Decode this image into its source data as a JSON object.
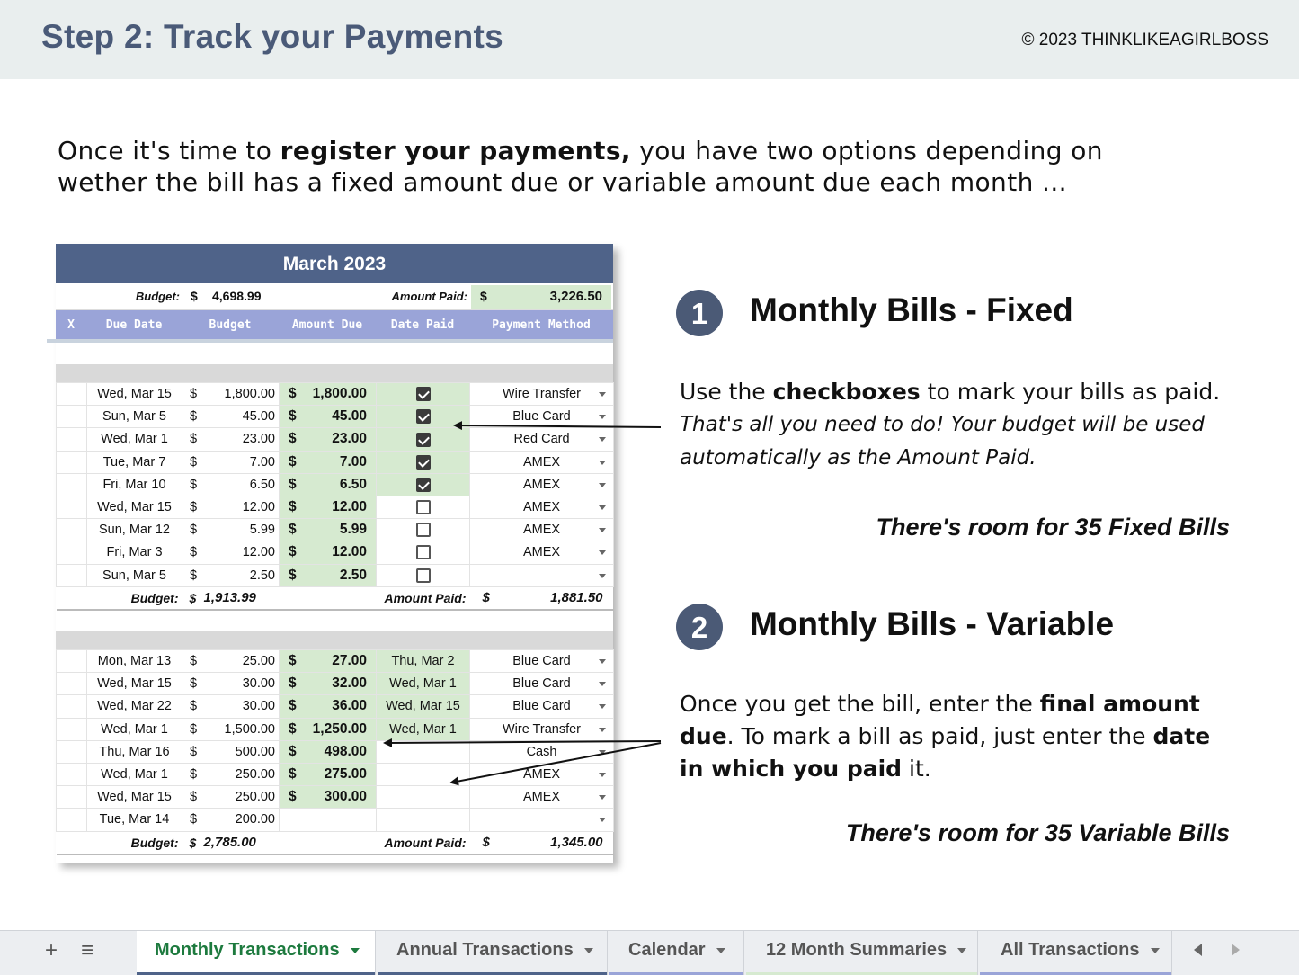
{
  "header": {
    "title": "Step 2: Track your Payments",
    "copyright": "©  2023 THINKLIKEAGIRLBOSS"
  },
  "intro": {
    "before": "Once it's time to ",
    "bold": "register your payments,",
    "after": " you have two options depending on wether the bill has a fixed amount due or variable amount due each month ..."
  },
  "sheet": {
    "month": "March 2023",
    "budget_label": "Budget:",
    "budget_dollar": "$",
    "budget_value": "4,698.99",
    "amount_paid_label": "Amount Paid:",
    "amount_paid_dollar": "$",
    "amount_paid_value": "3,226.50",
    "columns": [
      "X",
      "Due Date",
      "Budget",
      "Amount Due",
      "Date Paid",
      "Payment Method"
    ],
    "fixed_rows": [
      {
        "due": "Wed, Mar 15",
        "d": "$",
        "budget": "1,800.00",
        "ad": "$",
        "amount": "1,800.00",
        "checked": true,
        "method": "Wire Transfer"
      },
      {
        "due": "Sun, Mar 5",
        "d": "$",
        "budget": "45.00",
        "ad": "$",
        "amount": "45.00",
        "checked": true,
        "method": "Blue Card"
      },
      {
        "due": "Wed, Mar 1",
        "d": "$",
        "budget": "23.00",
        "ad": "$",
        "amount": "23.00",
        "checked": true,
        "method": "Red Card"
      },
      {
        "due": "Tue, Mar 7",
        "d": "$",
        "budget": "7.00",
        "ad": "$",
        "amount": "7.00",
        "checked": true,
        "method": "AMEX"
      },
      {
        "due": "Fri, Mar 10",
        "d": "$",
        "budget": "6.50",
        "ad": "$",
        "amount": "6.50",
        "checked": true,
        "method": "AMEX"
      },
      {
        "due": "Wed, Mar 15",
        "d": "$",
        "budget": "12.00",
        "ad": "$",
        "amount": "12.00",
        "checked": false,
        "method": "AMEX"
      },
      {
        "due": "Sun, Mar 12",
        "d": "$",
        "budget": "5.99",
        "ad": "$",
        "amount": "5.99",
        "checked": false,
        "method": "AMEX"
      },
      {
        "due": "Fri, Mar 3",
        "d": "$",
        "budget": "12.00",
        "ad": "$",
        "amount": "12.00",
        "checked": false,
        "method": "AMEX"
      },
      {
        "due": "Sun, Mar 5",
        "d": "$",
        "budget": "2.50",
        "ad": "$",
        "amount": "2.50",
        "checked": false,
        "method": ""
      }
    ],
    "fixed_total": {
      "budget_label": "Budget:",
      "dollar": "$",
      "budget": "1,913.99",
      "paid_label": "Amount Paid:",
      "paid_dollar": "$",
      "paid": "1,881.50"
    },
    "variable_rows": [
      {
        "due": "Mon, Mar 13",
        "d": "$",
        "budget": "25.00",
        "ad": "$",
        "amount": "27.00",
        "paid": "Thu, Mar 2",
        "method": "Blue Card"
      },
      {
        "due": "Wed, Mar 15",
        "d": "$",
        "budget": "30.00",
        "ad": "$",
        "amount": "32.00",
        "paid": "Wed, Mar 1",
        "method": "Blue Card"
      },
      {
        "due": "Wed, Mar 22",
        "d": "$",
        "budget": "30.00",
        "ad": "$",
        "amount": "36.00",
        "paid": "Wed, Mar 15",
        "method": "Blue Card"
      },
      {
        "due": "Wed, Mar 1",
        "d": "$",
        "budget": "1,500.00",
        "ad": "$",
        "amount": "1,250.00",
        "paid": "Wed, Mar 1",
        "method": "Wire Transfer"
      },
      {
        "due": "Thu, Mar 16",
        "d": "$",
        "budget": "500.00",
        "ad": "$",
        "amount": "498.00",
        "paid": "",
        "method": "Cash"
      },
      {
        "due": "Wed, Mar 1",
        "d": "$",
        "budget": "250.00",
        "ad": "$",
        "amount": "275.00",
        "paid": "",
        "method": "AMEX"
      },
      {
        "due": "Wed, Mar 15",
        "d": "$",
        "budget": "250.00",
        "ad": "$",
        "amount": "300.00",
        "paid": "",
        "method": "AMEX"
      },
      {
        "due": "Tue, Mar 14",
        "d": "$",
        "budget": "200.00",
        "ad": "",
        "amount": "",
        "paid": "",
        "method": ""
      }
    ],
    "variable_total": {
      "budget_label": "Budget:",
      "dollar": "$",
      "budget": "2,785.00",
      "paid_label": "Amount Paid:",
      "paid_dollar": "$",
      "paid": "1,345.00"
    }
  },
  "fixed": {
    "number": "1",
    "title": "Monthly Bills - Fixed",
    "line1_before": "Use the ",
    "line1_bold": "checkboxes",
    "line1_after": " to mark your bills as paid.",
    "italic1": "That's all you need to do! Your budget will be used",
    "italic2": "automatically as the Amount Paid.",
    "room": "There's room for 35 Fixed Bills"
  },
  "variable": {
    "number": "2",
    "title": "Monthly Bills - Variable",
    "p1": "Once you get the bill, enter the ",
    "b1": "final amount due",
    "p2": ". To mark a bill as paid, just enter the ",
    "b2": "date in which you paid",
    "p3": " it.",
    "room": "There's room for 35 Variable Bills"
  },
  "tabs": {
    "add": "+",
    "list": "≡",
    "items": [
      {
        "label": "Monthly Transactions",
        "color": "#4f6389"
      },
      {
        "label": "Annual Transactions",
        "color": "#4f6389"
      },
      {
        "label": "Calendar",
        "color": "#9aa4d8"
      },
      {
        "label": "12 Month Summaries",
        "color": "#d6ead0"
      },
      {
        "label": "All Transactions",
        "color": "#9aa4d8"
      }
    ]
  }
}
